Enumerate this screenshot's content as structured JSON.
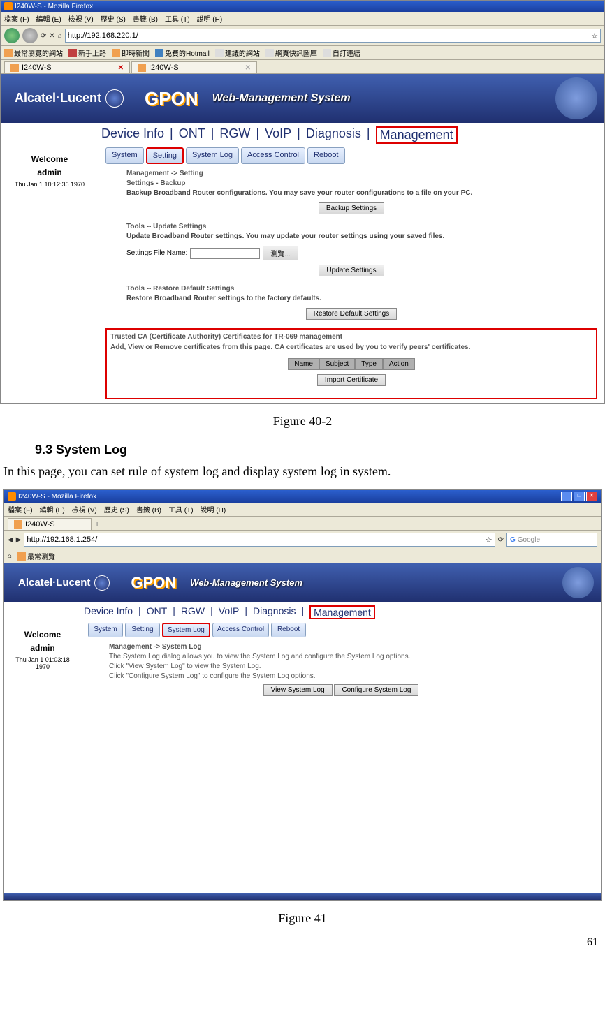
{
  "browser": {
    "title": "I240W-S - Mozilla Firefox",
    "menu": [
      "檔案 (F)",
      "編輯 (E)",
      "檢視 (V)",
      "歷史 (S)",
      "書籤 (B)",
      "工具 (T)",
      "說明 (H)"
    ],
    "url": "http://192.168.220.1/",
    "bookmarks": [
      "最常瀏覽的網站",
      "新手上路",
      "即時新聞",
      "免費的Hotmail",
      "建議的網站",
      "網頁快訊圖庫",
      "自訂連結"
    ],
    "tab": "I240W-S"
  },
  "app": {
    "logo": "Alcatel·Lucent",
    "gpon": "GPON",
    "subtitle": "Web-Management System",
    "maintabs": [
      "Device Info",
      "ONT",
      "RGW",
      "VoIP",
      "Diagnosis",
      "Management"
    ],
    "welcome": "Welcome",
    "user": "admin",
    "date1": "Thu Jan 1 10:12:36 1970",
    "date2": "Thu Jan 1 01:03:18 1970",
    "subtabs": [
      "System",
      "Setting",
      "System Log",
      "Access Control",
      "Reboot"
    ]
  },
  "p1": {
    "bc1": "Management -> Setting",
    "bc2": "Settings - Backup",
    "d1": "Backup Broadband Router configurations. You may save your router configurations to a file on your PC.",
    "b1": "Backup Settings",
    "t2": "Tools -- Update Settings",
    "d2": "Update Broadband Router settings. You may update your router settings using your saved files.",
    "fl": "Settings File Name:",
    "browse": "瀏覽...",
    "b2": "Update Settings",
    "t3": "Tools -- Restore Default Settings",
    "d3": "Restore Broadband Router settings to the factory defaults.",
    "b3": "Restore Default Settings",
    "ca1": "Trusted CA (Certificate Authority) Certificates for TR-069 management",
    "ca2": "Add, View or Remove certificates from this page. CA certificates are used by you to verify peers' certificates.",
    "cols": [
      "Name",
      "Subject",
      "Type",
      "Action"
    ],
    "b4": "Import Certificate"
  },
  "doc": {
    "fig1": "Figure 40-2",
    "sec": "9.3   System Log",
    "body": "In this page, you can set rule of system log and display system log in system.",
    "fig2": "Figure 41",
    "pagenum": "61"
  },
  "browser2": {
    "title": "I240W-S - Mozilla Firefox",
    "url": "http://192.168.1.254/",
    "search": "Google",
    "bm": "最常瀏覽"
  },
  "p2": {
    "bc": "Management -> System Log",
    "d1": "The System Log dialog allows you to view the System Log and configure the System Log options.",
    "d2": "Click \"View System Log\" to view the System Log.",
    "d3": "Click \"Configure System Log\" to configure the System Log options.",
    "b1": "View System Log",
    "b2": "Configure System Log"
  }
}
